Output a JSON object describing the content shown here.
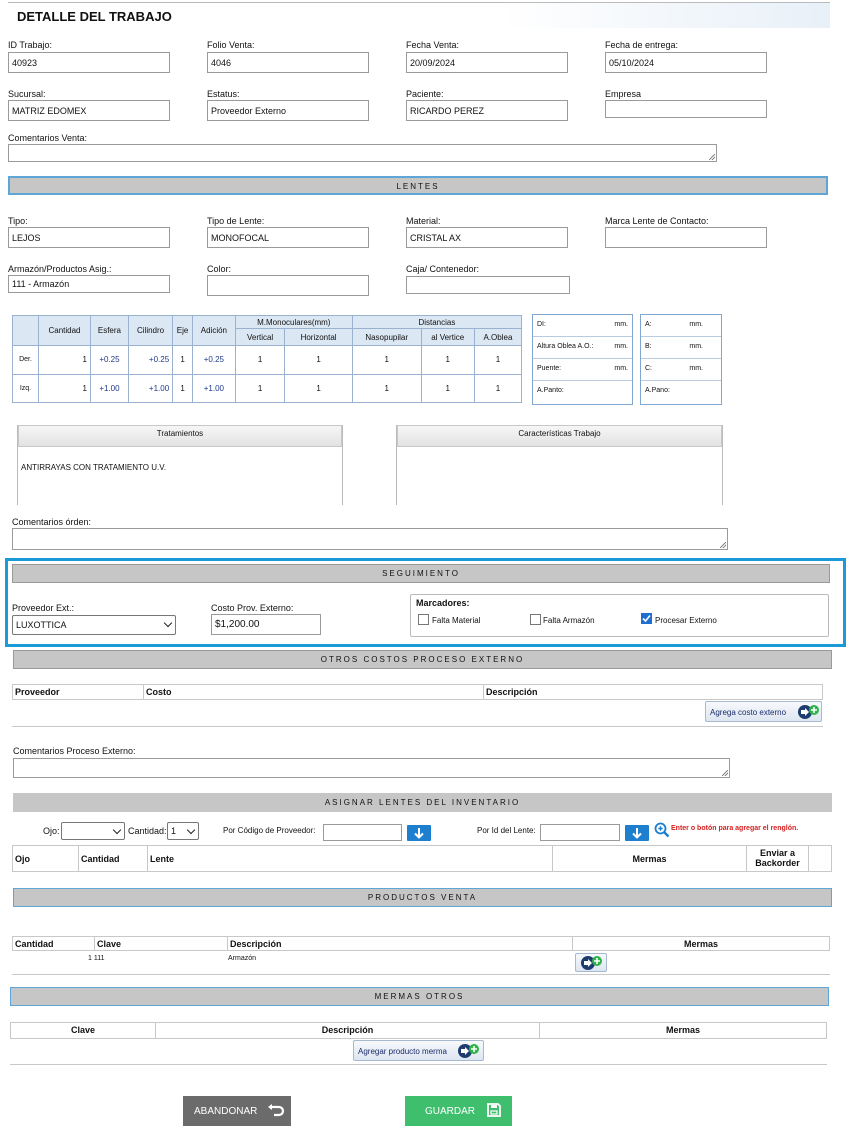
{
  "page_title": "DETALLE DEL TRABAJO",
  "venta": {
    "id_trabajo": {
      "label": "ID Trabajo:",
      "value": "40923"
    },
    "folio_venta": {
      "label": "Folio Venta:",
      "value": "4046"
    },
    "fecha_venta": {
      "label": "Fecha Venta:",
      "value": "20/09/2024"
    },
    "fecha_entrega": {
      "label": "Fecha de entrega:",
      "value": "05/10/2024"
    },
    "sucursal": {
      "label": "Sucursal:",
      "value": "MATRIZ EDOMEX"
    },
    "estatus": {
      "label": "Estatus:",
      "value": "Proveedor Externo"
    },
    "paciente": {
      "label": "Paciente:",
      "value": "RICARDO PEREZ"
    },
    "empresa": {
      "label": "Empresa",
      "value": ""
    },
    "comentarios_label": "Comentarios Venta:"
  },
  "lentes": {
    "section_title": "LENTES",
    "tipo": {
      "label": "Tipo:",
      "value": "LEJOS"
    },
    "tipo_lente": {
      "label": "Tipo de Lente:",
      "value": "MONOFOCAL"
    },
    "material": {
      "label": "Material:",
      "value": "CRISTAL AX"
    },
    "marca_contacto": {
      "label": "Marca Lente de Contacto:",
      "value": ""
    },
    "armazon": {
      "label": "Armazón/Productos Asig.:",
      "value": "111 - Armazón"
    },
    "color": {
      "label": "Color:",
      "value": ""
    },
    "caja": {
      "label": "Caja/ Contenedor:",
      "value": ""
    }
  },
  "graduacion": {
    "headers": {
      "cantidad": "Cantidad",
      "esfera": "Esfera",
      "cilindro": "Cilindro",
      "eje": "Eje",
      "adicion": "Adición",
      "mono": "M.Monoculares(mm)",
      "distancias": "Distancias",
      "vertical": "Vertical",
      "horizontal": "Horizontal",
      "nasopupilar": "Nasopupilar",
      "vertice": "al Vertice",
      "aoblea": "A.Oblea"
    },
    "rows": [
      {
        "ojo": "Der.",
        "cantidad": "1",
        "esfera": "+0.25",
        "cilindro": "+0.25",
        "eje": "1",
        "adicion": "+0.25",
        "vertical": "1",
        "horizontal": "1",
        "nasopupilar": "1",
        "vertice": "1",
        "aoblea": "1"
      },
      {
        "ojo": "Izq.",
        "cantidad": "1",
        "esfera": "+1.00",
        "cilindro": "+1.00",
        "eje": "1",
        "adicion": "+1.00",
        "vertical": "1",
        "horizontal": "1",
        "nasopupilar": "1",
        "vertice": "1",
        "aoblea": "1"
      }
    ]
  },
  "medidas1": [
    {
      "label": "DI:",
      "unit": "mm."
    },
    {
      "label": "Altura Oblea A.O.:",
      "unit": "mm."
    },
    {
      "label": "Puente:",
      "unit": "mm."
    },
    {
      "label": "A.Panto:",
      "unit": ""
    }
  ],
  "medidas2": [
    {
      "label": "A:",
      "unit": "mm."
    },
    {
      "label": "B:",
      "unit": "mm."
    },
    {
      "label": "C:",
      "unit": "mm."
    },
    {
      "label": "A.Pano:",
      "unit": ""
    }
  ],
  "tratamientos": {
    "title": "Tratamientos",
    "value": "ANTIRRAYAS CON TRATAMIENTO U.V."
  },
  "caracteristicas": {
    "title": "Características Trabajo"
  },
  "comentarios_orden_label": "Comentarios órden:",
  "seguimiento": {
    "section_title": "SEGUIMIENTO",
    "proveedor_label": "Proveedor Ext.:",
    "proveedor_value": "LUXOTTICA",
    "costo_label": "Costo Prov. Externo:",
    "costo_value": "$1,200.00",
    "marcadores_label": "Marcadores:",
    "falta_material": "Falta Material",
    "falta_armazon": "Falta Armazón",
    "procesar_externo": "Procesar Externo"
  },
  "otros_costos": {
    "section_title": "OTROS COSTOS PROCESO EXTERNO",
    "col_proveedor": "Proveedor",
    "col_costo": "Costo",
    "col_descripcion": "Descripción",
    "add_button": "Agrega costo externo",
    "comentarios_label": "Comentarios Proceso Externo:"
  },
  "asignar": {
    "section_title": "ASIGNAR LENTES DEL INVENTARIO",
    "ojo_label": "Ojo:",
    "cantidad_label": "Cantidad:",
    "cantidad_value": "1",
    "codigo_label": "Por Código de Proveedor:",
    "id_label": "Por Id del Lente:",
    "hint": "Enter o botón para agregar el renglón.",
    "col_ojo": "Ojo",
    "col_cantidad": "Cantidad",
    "col_lente": "Lente",
    "col_mermas": "Mermas",
    "col_backorder": "Enviar a Backorder"
  },
  "productos": {
    "section_title": "PRODUCTOS VENTA",
    "col_cantidad": "Cantidad",
    "col_clave": "Clave",
    "col_descripcion": "Descripción",
    "col_mermas": "Mermas",
    "row_cantidad_clave": "1 111",
    "row_descripcion": "Armazón"
  },
  "mermas": {
    "section_title": "MERMAS OTROS",
    "col_clave": "Clave",
    "col_descripcion": "Descripción",
    "col_mermas": "Mermas",
    "add_button": "Agregar producto merma"
  },
  "actions": {
    "abandonar": "ABANDONAR",
    "guardar": "GUARDAR"
  },
  "colors": {
    "accent_blue": "#1a9ad6",
    "guardar_green": "#3fbf6e",
    "abandonar_gray": "#6b6b6b"
  }
}
